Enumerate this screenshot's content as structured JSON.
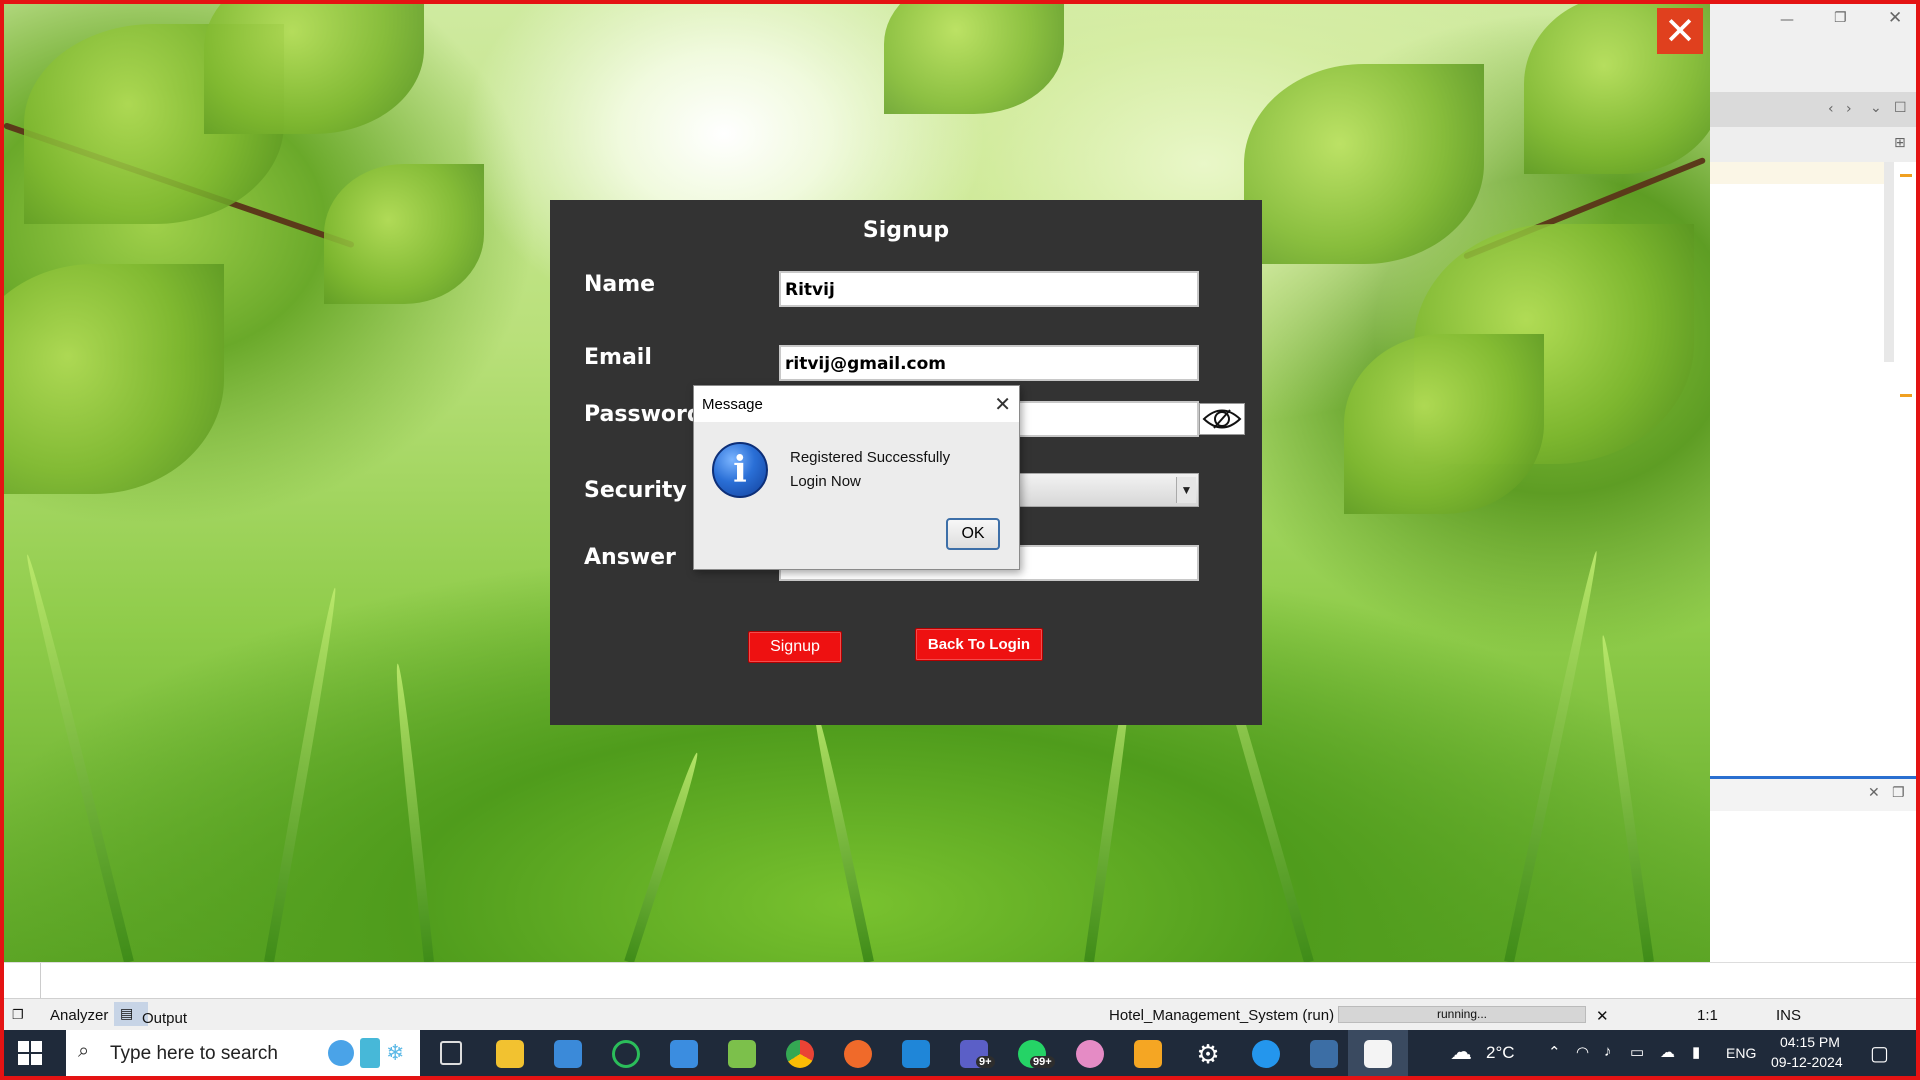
{
  "colors": {
    "accent_red": "#ee1111",
    "panel_bg": "#333333",
    "frame_red": "#e41313",
    "taskbar_bg": "#1f2a3a"
  },
  "signup": {
    "title": "Signup",
    "labels": {
      "name": "Name",
      "email": "Email",
      "password": "Password",
      "security": "Security Q",
      "answer": "Answer"
    },
    "values": {
      "name": "Ritvij",
      "email": "ritvij@gmail.com",
      "password": "",
      "answer": ""
    },
    "eye_icon": "eye-slash-icon",
    "signup_button": "Signup",
    "back_button": "Back To Login"
  },
  "dialog": {
    "title": "Message",
    "line1": "Registered Successfully",
    "line2": "Login Now",
    "ok_label": "OK",
    "icon": "info-icon",
    "close_glyph": "✕"
  },
  "app_close_glyph": "✕",
  "status_bar": {
    "analyzer_label": "Analyzer",
    "output_label": "Output",
    "process": "Hotel_Management_System (run)",
    "progress_text": "running...",
    "cancel_glyph": "✕",
    "caret_pos": "1:1",
    "insert_mode": "INS"
  },
  "taskbar": {
    "search_placeholder": "Type here to search",
    "weather": "2°C",
    "language": "ENG",
    "time": "04:15 PM",
    "date": "09-12-2024",
    "whatsapp_badge": "99+",
    "teams_badge": "9+"
  }
}
